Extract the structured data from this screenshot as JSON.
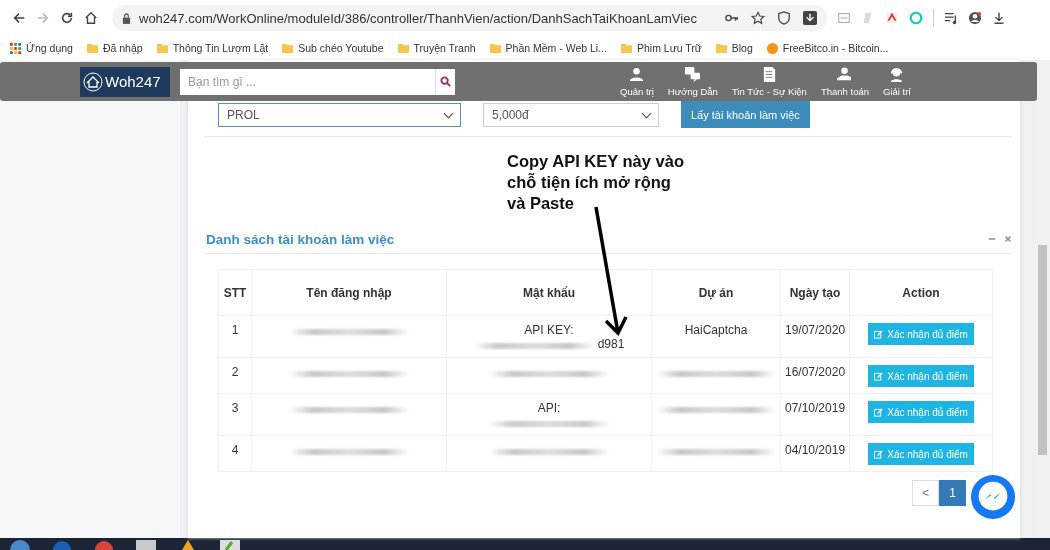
{
  "browser": {
    "url": "woh247.com/WorkOnline/moduleId/386/controller/ThanhVien/action/DanhSachTaiKhoanLamViec"
  },
  "bookmarks": [
    {
      "kind": "apps",
      "label": "Ứng dụng"
    },
    {
      "kind": "folder",
      "label": "Đã nhập"
    },
    {
      "kind": "folder",
      "label": "Thông Tin Lượm Lặt"
    },
    {
      "kind": "folder",
      "label": "Sub chéo Youtube"
    },
    {
      "kind": "folder",
      "label": "Truyện Tranh"
    },
    {
      "kind": "folder",
      "label": "Phần Mềm - Web Li..."
    },
    {
      "kind": "folder",
      "label": "Phim Lưu Trữ"
    },
    {
      "kind": "folder",
      "label": "Blog"
    },
    {
      "kind": "site",
      "label": "FreeBitco.in - Bitcoin..."
    }
  ],
  "header": {
    "logo": "Woh247",
    "search": {
      "placeholder": "Bạn tìm gì ..."
    },
    "nav": [
      {
        "kind": "user",
        "label": "Quản trị"
      },
      {
        "kind": "help",
        "label": "Hướng Dẫn"
      },
      {
        "kind": "news",
        "label": "Tin Tức - Sự Kiện"
      },
      {
        "kind": "pay",
        "label": "Thanh toán"
      },
      {
        "kind": "fun",
        "label": "Giải trí"
      }
    ]
  },
  "filters": {
    "project": "PROL",
    "amount": "5,000đ",
    "button": "Lấy tài khoản làm việc"
  },
  "annotation": "Copy API KEY này vào chỗ tiện ích mở rộng và Paste",
  "panel": {
    "title": "Danh sách tài khoản làm việc",
    "columns": [
      "STT",
      "Tên đăng nhập",
      "Mật khẩu",
      "Dự án",
      "Ngày tạo",
      "Action"
    ],
    "rows": [
      {
        "cells": [
          [
            [
              {
                "kind": "text",
                "text": "1"
              }
            ]
          ],
          [
            [
              {
                "kind": "blur"
              }
            ]
          ],
          [
            [
              {
                "kind": "text",
                "text": "API KEY:"
              }
            ],
            [
              {
                "kind": "blur"
              },
              {
                "kind": "text",
                "text": "d981"
              }
            ]
          ],
          [
            [
              {
                "kind": "text",
                "text": "HaiCaptcha"
              }
            ]
          ],
          [
            [
              {
                "kind": "text",
                "text": "19/07/2020"
              }
            ]
          ]
        ],
        "action": "Xác nhận đủ điểm"
      },
      {
        "cells": [
          [
            [
              {
                "kind": "text",
                "text": "2"
              }
            ]
          ],
          [
            [
              {
                "kind": "blur"
              }
            ]
          ],
          [
            [
              {
                "kind": "blur"
              }
            ]
          ],
          [
            [
              {
                "kind": "blur"
              }
            ]
          ],
          [
            [
              {
                "kind": "text",
                "text": "16/07/2020"
              }
            ]
          ]
        ],
        "action": "Xác nhận đủ điểm"
      },
      {
        "cells": [
          [
            [
              {
                "kind": "text",
                "text": "3"
              }
            ]
          ],
          [
            [
              {
                "kind": "blur"
              }
            ]
          ],
          [
            [
              {
                "kind": "text",
                "text": "API:"
              }
            ],
            [
              {
                "kind": "blur"
              }
            ]
          ],
          [
            [
              {
                "kind": "blur"
              }
            ]
          ],
          [
            [
              {
                "kind": "text",
                "text": "07/10/2019"
              }
            ]
          ]
        ],
        "action": "Xác nhận đủ điểm"
      },
      {
        "cells": [
          [
            [
              {
                "kind": "text",
                "text": "4"
              }
            ]
          ],
          [
            [
              {
                "kind": "blur"
              }
            ]
          ],
          [
            [
              {
                "kind": "blur"
              }
            ]
          ],
          [
            [
              {
                "kind": "blur"
              }
            ]
          ],
          [
            [
              {
                "kind": "text",
                "text": "04/10/2019"
              }
            ]
          ]
        ],
        "action": "Xác nhận đủ điểm"
      }
    ]
  },
  "pagination": [
    {
      "label": "<",
      "selected": false
    },
    {
      "label": "1",
      "selected": true
    }
  ]
}
